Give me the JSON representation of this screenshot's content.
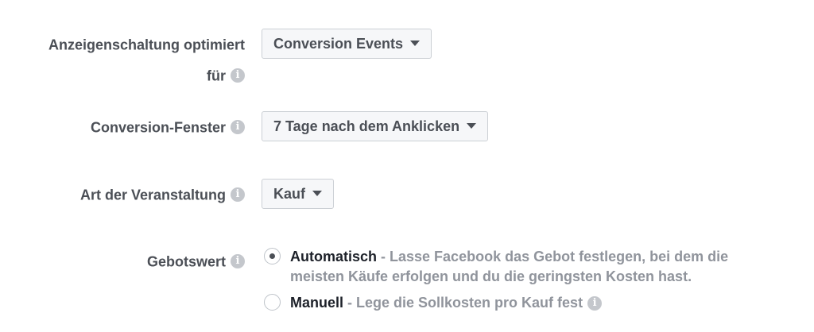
{
  "fields": {
    "optimization": {
      "label_line1": "Anzeigenschaltung optimiert",
      "label_line2": "für",
      "value": "Conversion Events"
    },
    "conversion_window": {
      "label": "Conversion-Fenster",
      "value": "7 Tage nach dem Anklicken"
    },
    "event_type": {
      "label": "Art der Veranstaltung",
      "value": "Kauf"
    },
    "bid_value": {
      "label": "Gebotswert",
      "options": [
        {
          "title": "Automatisch",
          "desc": " - Lasse Facebook das Gebot festlegen, bei dem die meisten Käufe erfolgen und du die geringsten Kosten hast.",
          "selected": true
        },
        {
          "title": "Manuell",
          "desc": " - Lege die Sollkosten pro Kauf fest",
          "selected": false
        }
      ]
    }
  },
  "icons": {
    "info": "info-icon",
    "caret": "caret-down-icon"
  },
  "info_glyph": "i"
}
